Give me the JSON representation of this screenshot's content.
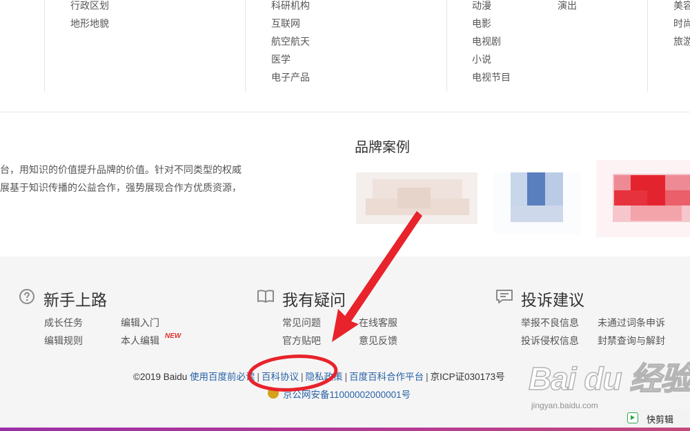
{
  "categories": {
    "col1": [
      "行政区划",
      "地形地貌"
    ],
    "col2": [
      "科研机构",
      "互联网",
      "航空航天",
      "医学",
      "电子产品"
    ],
    "col3": [
      "动漫",
      "电影",
      "电视剧",
      "小说",
      "电视节目"
    ],
    "col3b": [
      "演出"
    ],
    "col4": [
      "美容",
      "时尚",
      "旅游"
    ]
  },
  "brand": {
    "title": "品牌案例",
    "desc_line1": "台，用知识的价值提升品牌的价值。针对不同类型的权威",
    "desc_line2": "展基于知识传播的公益合作，强势展现合作方优质资源，"
  },
  "footer": {
    "sections": [
      {
        "title": "新手上路",
        "icon": "question-circle-icon",
        "links": [
          "成长任务",
          "编辑入门",
          "编辑规则",
          "本人编辑"
        ],
        "badge": "NEW"
      },
      {
        "title": "我有疑问",
        "icon": "book-icon",
        "links": [
          "常见问题",
          "在线客服",
          "官方贴吧",
          "意见反馈"
        ]
      },
      {
        "title": "投诉建议",
        "icon": "chat-icon",
        "links": [
          "举报不良信息",
          "未通过词条申诉",
          "投诉侵权信息",
          "封禁查询与解封"
        ]
      }
    ],
    "copyright": "©2019 Baidu",
    "bottom_links": [
      "使用百度前必读",
      "百科协议",
      "隐私政策",
      "百度百科合作平台"
    ],
    "icp": "京ICP证030173号",
    "beian": "京公网安备11000002000001号"
  },
  "watermark": {
    "main": "Bai du 经验",
    "sub": "jingyan.baidu.com"
  },
  "taskbar": {
    "app_label": "快剪辑"
  },
  "annotation_colors": {
    "arrow": "#e8232b",
    "circle": "#e8232b"
  }
}
